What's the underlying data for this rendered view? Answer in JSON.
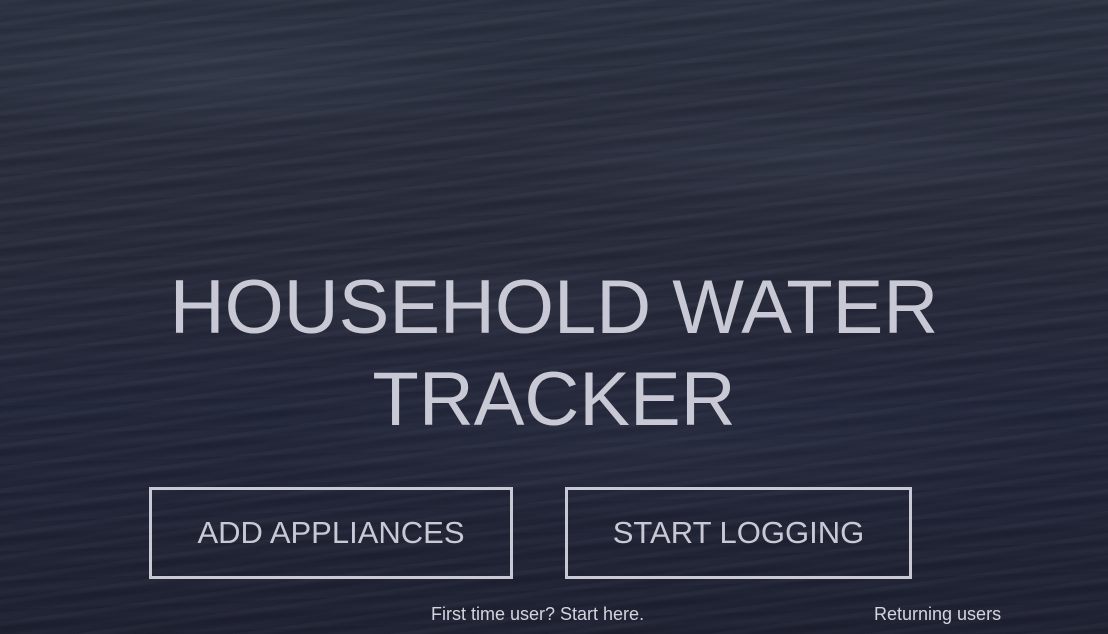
{
  "hero": {
    "title_line1": "HOUSEHOLD WATER",
    "title_line2": "TRACKER"
  },
  "actions": {
    "add_appliances_label": "ADD APPLIANCES",
    "start_logging_label": "START LOGGING"
  },
  "captions": {
    "first_time": "First time user? Start here.",
    "returning": "Returning users"
  },
  "colors": {
    "text": "#c9c9d6",
    "background": "#242838"
  }
}
